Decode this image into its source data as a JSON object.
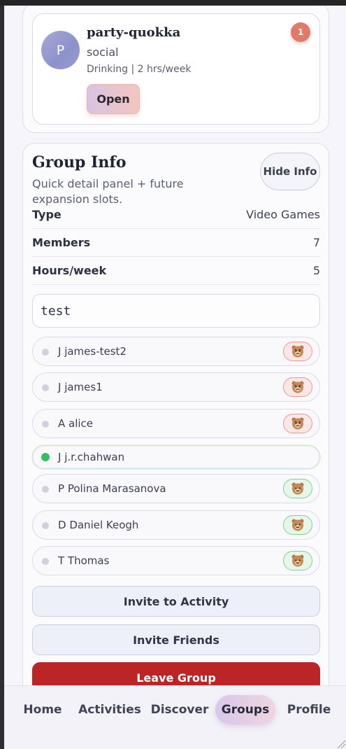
{
  "group_card": {
    "avatar_letter": "P",
    "name": "party-quokka",
    "category": "social",
    "meta": "Drinking | 2 hrs/week",
    "open_label": "Open",
    "notification_count": "1"
  },
  "group_info": {
    "title": "Group Info",
    "subtitle": "Quick detail panel + future expansion slots.",
    "hide_label": "Hide Info",
    "fields": [
      {
        "key": "Type",
        "value": "Video Games"
      },
      {
        "key": "Members",
        "value": "7"
      },
      {
        "key": "Hours/week",
        "value": "5"
      }
    ],
    "search_value": "test"
  },
  "members": [
    {
      "label": "J james-test2",
      "online": false,
      "mood": "angry"
    },
    {
      "label": "J james1",
      "online": false,
      "mood": "angry"
    },
    {
      "label": "A alice",
      "online": false,
      "mood": "angry"
    },
    {
      "label": "J j.r.chahwan",
      "online": true,
      "mood": ""
    },
    {
      "label": "P Polina Marasanova",
      "online": false,
      "mood": "happy"
    },
    {
      "label": "D Daniel Keogh",
      "online": false,
      "mood": "happy"
    },
    {
      "label": "T Thomas",
      "online": false,
      "mood": "happy"
    }
  ],
  "actions": {
    "invite_activity": "Invite to Activity",
    "invite_friends": "Invite Friends",
    "leave_group": "Leave Group"
  },
  "nav": {
    "home": "Home",
    "activities": "Activities",
    "discover": "Discover",
    "groups": "Groups",
    "profile": "Profile",
    "active": "Groups"
  },
  "colors": {
    "online_dot": "#33c160",
    "leave_button": "#bb2525",
    "notification": "#e07b6a"
  }
}
